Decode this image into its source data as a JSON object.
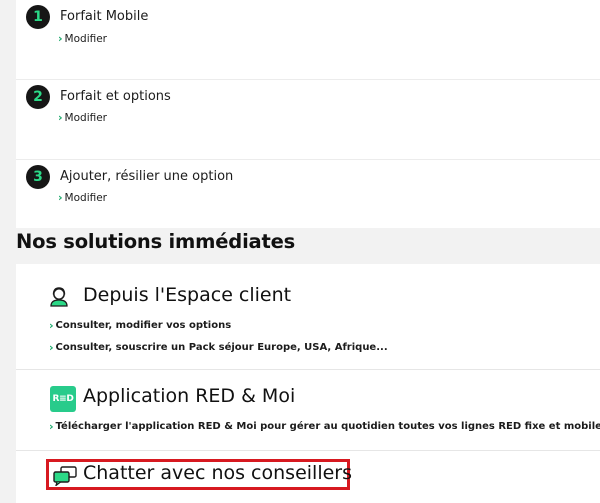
{
  "steps": [
    {
      "number": "1",
      "title": "Forfait Mobile",
      "link": "Modifier"
    },
    {
      "number": "2",
      "title": "Forfait et options",
      "link": "Modifier"
    },
    {
      "number": "3",
      "title": "Ajouter, résilier une option",
      "link": "Modifier"
    }
  ],
  "section_title": "Nos solutions immédiates",
  "solutions": {
    "espace_client": {
      "title": "Depuis l'Espace client",
      "icon": "user-support-icon",
      "links": [
        "Consulter, modifier vos options",
        "Consulter, souscrire un Pack séjour Europe, USA, Afrique..."
      ]
    },
    "app": {
      "title": "Application RED & Moi",
      "icon_text": "R≡D",
      "links": [
        "Télécharger l'application RED & Moi pour gérer au quotidien toutes vos lignes RED fixe et mobile."
      ]
    },
    "chat": {
      "title": "Chatter avec nos conseillers",
      "icon": "chat-bubbles-icon"
    }
  },
  "colors": {
    "accent": "#2bd987",
    "badge_bg": "#161616",
    "highlight": "#d71920",
    "app_icon_bg": "#28cb8b"
  }
}
